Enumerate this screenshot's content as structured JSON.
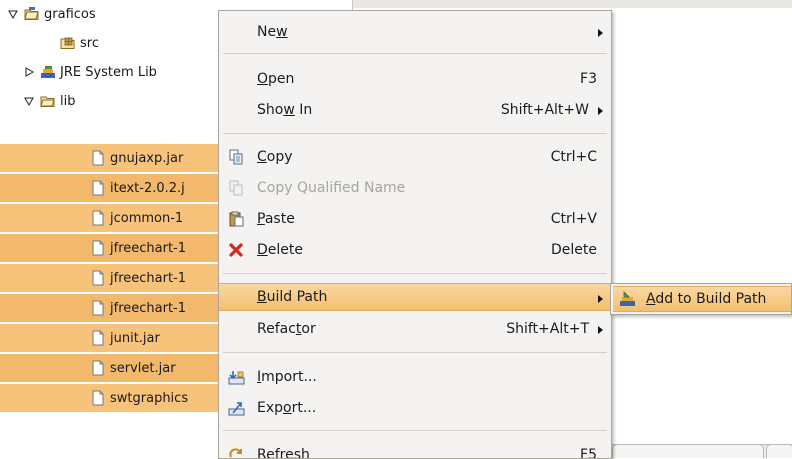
{
  "tree": {
    "rows": [
      {
        "label": "graficos",
        "expanded": true,
        "icon": "project-folder-icon"
      },
      {
        "label": "src",
        "icon": "source-folder-icon"
      },
      {
        "label": "JRE System Lib",
        "expanded": false,
        "icon": "library-icon"
      },
      {
        "label": "lib",
        "expanded": true,
        "icon": "folder-icon"
      },
      {
        "label": "gnujaxp.jar",
        "icon": "file-icon",
        "selected": true
      },
      {
        "label": "itext-2.0.2.j",
        "icon": "file-icon",
        "selected": true
      },
      {
        "label": "jcommon-1",
        "icon": "file-icon",
        "selected": true
      },
      {
        "label": "jfreechart-1",
        "icon": "file-icon",
        "selected": true
      },
      {
        "label": "jfreechart-1",
        "icon": "file-icon",
        "selected": true
      },
      {
        "label": "jfreechart-1",
        "icon": "file-icon",
        "selected": true
      },
      {
        "label": "junit.jar",
        "icon": "file-icon",
        "selected": true
      },
      {
        "label": "servlet.jar",
        "icon": "file-icon",
        "selected": true
      },
      {
        "label": "swtgraphics",
        "icon": "file-icon",
        "selected": true
      }
    ]
  },
  "menu": {
    "new": {
      "pre": "Ne",
      "mn": "w",
      "post": ""
    },
    "open": {
      "pre": "",
      "mn": "O",
      "post": "pen",
      "shortcut": "F3"
    },
    "show_in": {
      "pre": "Sho",
      "mn": "w",
      "post": " In",
      "shortcut": "Shift+Alt+W"
    },
    "copy": {
      "pre": "",
      "mn": "C",
      "post": "opy",
      "shortcut": "Ctrl+C"
    },
    "copy_qualified": {
      "label": "Copy Qualified Name"
    },
    "paste": {
      "pre": "",
      "mn": "P",
      "post": "aste",
      "shortcut": "Ctrl+V"
    },
    "delete": {
      "pre": "",
      "mn": "D",
      "post": "elete",
      "shortcut": "Delete"
    },
    "build_path": {
      "pre": "",
      "mn": "B",
      "post": "uild Path"
    },
    "refactor": {
      "pre": "Refac",
      "mn": "t",
      "post": "or",
      "shortcut": "Shift+Alt+T"
    },
    "import": {
      "pre": "",
      "mn": "I",
      "post": "mport..."
    },
    "export": {
      "pre": "Exp",
      "mn": "o",
      "post": "rt..."
    },
    "refresh": {
      "pre": "Re",
      "mn": "f",
      "post": "resh",
      "shortcut": "F5"
    }
  },
  "submenu": {
    "add_to_build_path": {
      "pre": "",
      "mn": "A",
      "post": "dd to Build Path"
    }
  },
  "colors": {
    "selection": "#f7c27a",
    "menu_highlight": "#f3bf6e",
    "menu_bg": "#f4f3f1"
  }
}
